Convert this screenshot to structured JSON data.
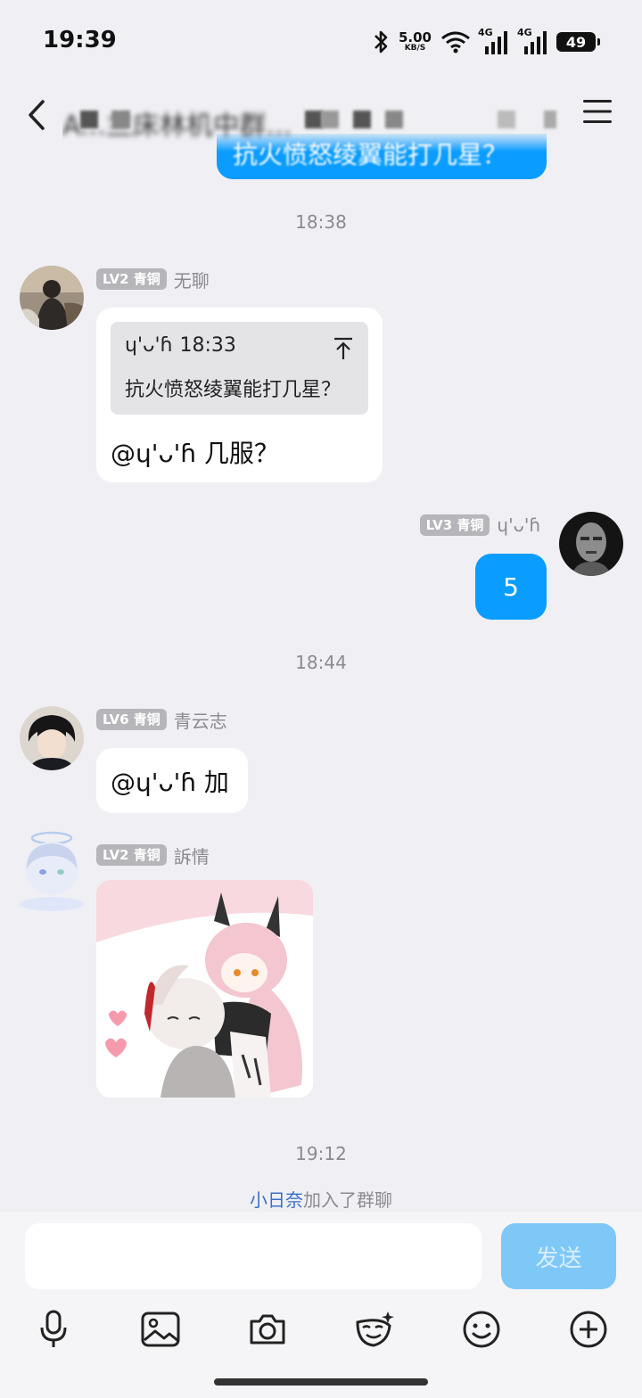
{
  "status_bar": {
    "time": "19:39",
    "net_speed": "5.00",
    "net_unit": "KB/S",
    "network1": "4G",
    "network2": "4G",
    "battery": "49"
  },
  "header": {
    "title": "A...兰床林机中群..."
  },
  "peek_message": "抗火愤怒绫翼能打几星？",
  "timestamps": [
    "18:38",
    "18:44",
    "19:12"
  ],
  "messages": [
    {
      "level": "LV2 青铜",
      "nickname": "无聊",
      "quote": {
        "author": "ɥ'ᴗ'ɦ",
        "time": "18:33",
        "text": "抗火愤怒绫翼能打几星？"
      },
      "text": "@ɥ'ᴗ'ɦ 几服？"
    },
    {
      "level": "LV3 青铜",
      "nickname": "ɥ'ᴗ'ɦ",
      "text": "5"
    },
    {
      "level": "LV6 青铜",
      "nickname": "青云志",
      "text": "@ɥ'ᴗ'ɦ 加"
    },
    {
      "level": "LV2 青铜",
      "nickname": "訴情",
      "sticker": "anime-sticker"
    }
  ],
  "system_message": {
    "user": "小日奈",
    "action": "加入了群聊"
  },
  "composer": {
    "placeholder": "",
    "send_label": "发送"
  },
  "toolbar": [
    "mic-icon",
    "image-icon",
    "camera-icon",
    "sticker-icon",
    "emoji-icon",
    "plus-icon"
  ],
  "colors": {
    "accent": "#0a9cff",
    "send_disabled": "#7ec8f8",
    "background": "#f0f0f4"
  }
}
